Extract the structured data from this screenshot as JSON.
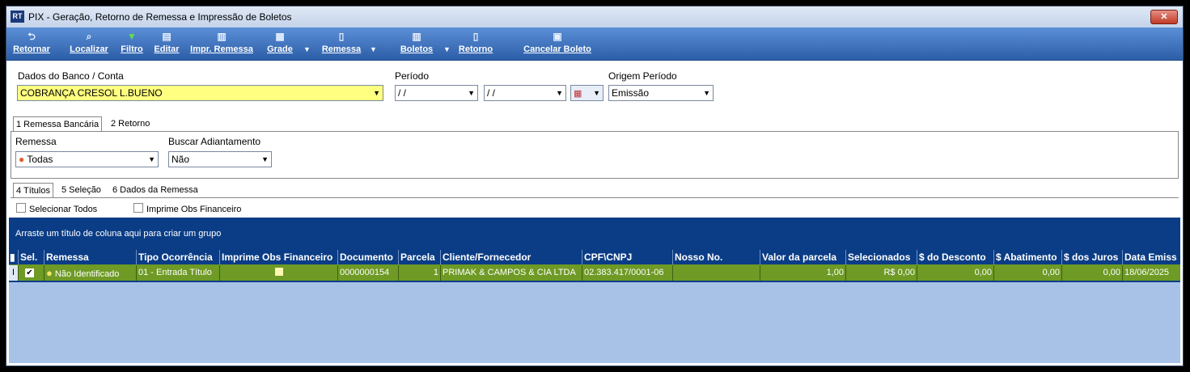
{
  "window": {
    "title": "PIX - Geração, Retorno de Remessa e Impressão de Boletos",
    "icon_text": "RT",
    "close_label": "✕"
  },
  "toolbar": {
    "retornar": "Retornar",
    "localizar": "Localizar",
    "filtro": "Filtro",
    "editar": "Editar",
    "impr_remessa": "Impr. Remessa",
    "grade": "Grade",
    "remessa": "Remessa",
    "boletos": "Boletos",
    "retorno": "Retorno",
    "cancelar_boleto": "Cancelar Boleto"
  },
  "filters": {
    "banco_label": "Dados do Banco / Conta",
    "banco_value": "COBRANÇA CRESOL L.BUENO",
    "periodo_label": "Período",
    "periodo_inicio": "/ /",
    "periodo_fim": "/ /",
    "origem_label": "Origem Período",
    "origem_value": "Emissão"
  },
  "tabs_top": [
    {
      "label": "1 Remessa Bancária"
    },
    {
      "label": "2 Retorno"
    }
  ],
  "remessa_panel": {
    "remessa_label": "Remessa",
    "remessa_value": "Todas",
    "adiantamento_label": "Buscar Adiantamento",
    "adiantamento_value": "Não"
  },
  "tabs_inner": [
    {
      "label": "4 Títulos"
    },
    {
      "label": "5 Seleção"
    },
    {
      "label": "6 Dados da Remessa"
    }
  ],
  "options": {
    "selecionar_todos": "Selecionar Todos",
    "imprime_obs": "Imprime Obs Financeiro"
  },
  "grid": {
    "group_hint": "Arraste um título de coluna aqui para criar um grupo",
    "row_indicator": "I",
    "columns": [
      "Sel.",
      "Remessa",
      "Tipo Ocorrência",
      "Imprime Obs Financeiro",
      "Documento",
      "Parcela",
      "Cliente/Fornecedor",
      "CPF\\CNPJ",
      "Nosso No.",
      "Valor da parcela",
      "Selecionados",
      "$ do Desconto",
      "$ Abatimento",
      "$ dos Juros",
      "Data Emiss"
    ],
    "rows": [
      {
        "remessa": "Não Identificado",
        "tipo": "01 - Entrada Título",
        "documento": "0000000154",
        "parcela": "1",
        "cliente": "PRIMAK & CAMPOS & CIA LTDA",
        "cnpj": "02.383.417/0001-06",
        "nosso_no": "",
        "valor": "1,00",
        "selecionados": "R$ 0,00",
        "desconto": "0,00",
        "abatimento": "0,00",
        "juros": "0,00",
        "data": "18/06/2025"
      }
    ]
  }
}
